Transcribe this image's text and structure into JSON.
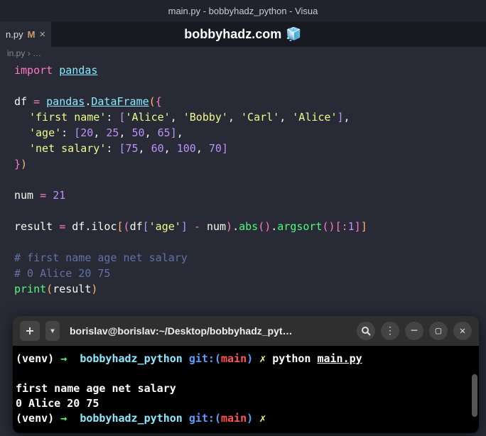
{
  "window": {
    "title": "main.py - bobbyhadz_python - Visua"
  },
  "tab": {
    "filename": "n.py",
    "modified_indicator": "M",
    "close": "×"
  },
  "overlay": {
    "text": "bobbyhadz.com",
    "icon": "🧊"
  },
  "breadcrumb": {
    "file": "in.py",
    "sep": "›",
    "more": "…"
  },
  "code": {
    "l1": {
      "kw": "import",
      "mod": "pandas"
    },
    "l3": {
      "var": "df",
      "op": "=",
      "mod": "pandas",
      "dot": ".",
      "cls": "DataFrame",
      "open": "({"
    },
    "l4": {
      "key": "'first name'",
      "colon": ":",
      "vals": [
        "'Alice'",
        "'Bobby'",
        "'Carl'",
        "'Alice'"
      ]
    },
    "l5": {
      "key": "'age'",
      "colon": ":",
      "vals": [
        "20",
        "25",
        "50",
        "65"
      ]
    },
    "l6": {
      "key": "'net salary'",
      "colon": ":",
      "vals": [
        "75",
        "60",
        "100",
        "70"
      ]
    },
    "l7": {
      "close": "})"
    },
    "l9": {
      "var": "num",
      "op": "=",
      "val": "21"
    },
    "l11": {
      "var": "result",
      "op": "=",
      "expr_df": "df",
      "dot": ".",
      "iloc": "iloc",
      "age": "'age'",
      "minus": "-",
      "num": "num",
      "abs": "abs",
      "argsort": "argsort",
      "slice": ":1"
    },
    "l13": "#   first name  age  net salary",
    "l14": "# 0      Alice   20          75",
    "l15": {
      "fn": "print",
      "arg": "result"
    }
  },
  "terminal": {
    "title": "borislav@borislav:~/Desktop/bobbyhadz_pyt…",
    "prompt": {
      "venv": "(venv)",
      "arrow": "→",
      "dir": "bobbyhadz_python",
      "git_label": "git:(",
      "branch": "main",
      "git_close": ")",
      "dirty": "✗",
      "cmd": "python",
      "arg": "main.py"
    },
    "output_header": "  first name  age  net salary",
    "output_row": "0      Alice   20          75"
  }
}
